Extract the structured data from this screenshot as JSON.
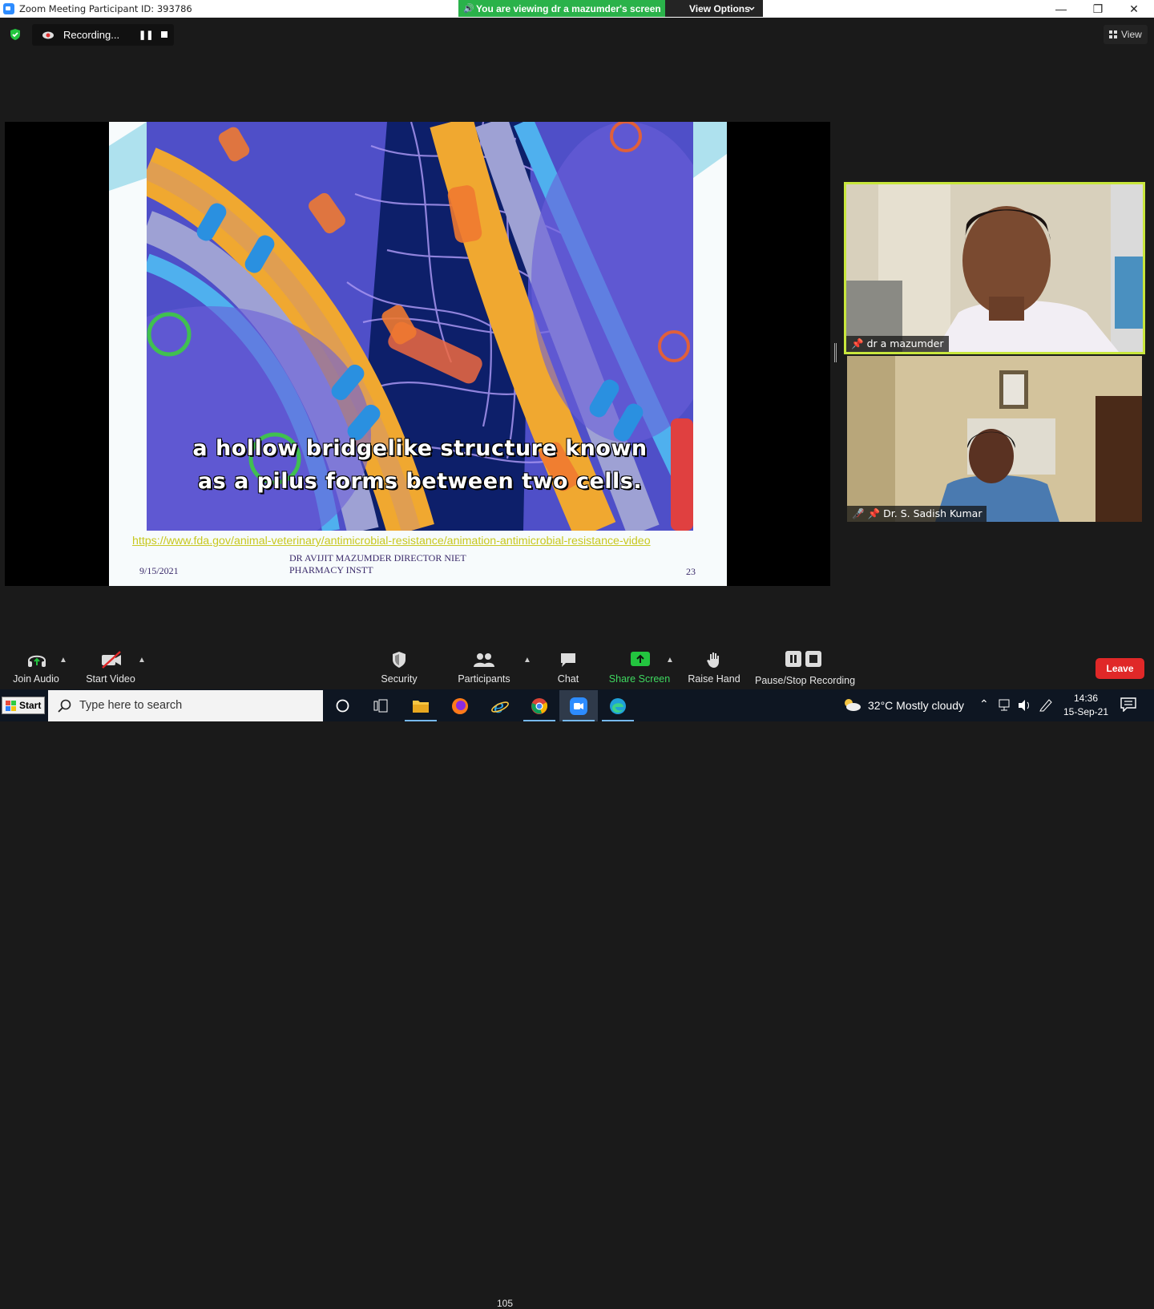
{
  "window": {
    "title": "Zoom Meeting Participant ID: 393786",
    "viewing_banner": "You are viewing dr a mazumder's screen",
    "view_options": "View Options",
    "minimize": "—",
    "maximize": "❐",
    "close": "✕"
  },
  "top_bar": {
    "recording_label": "Recording...",
    "view_label": "View"
  },
  "slide": {
    "caption_line1": "a hollow bridgelike structure known",
    "caption_line2": "as a pilus forms between two cells.",
    "url": "https://www.fda.gov/animal-veterinary/antimicrobial-resistance/animation-antimicrobial-resistance-video",
    "date": "9/15/2021",
    "author_line1": "DR AVIJIT MAZUMDER DIRECTOR NIET",
    "author_line2": "PHARMACY INSTT",
    "page_number": "23"
  },
  "participants": [
    {
      "name": "dr a mazumder",
      "active_speaker": true,
      "muted": false
    },
    {
      "name": "Dr. S. Sadish Kumar",
      "active_speaker": false,
      "muted": true
    }
  ],
  "toolbar": {
    "join_audio": "Join Audio",
    "start_video": "Start Video",
    "security": "Security",
    "participants": "Participants",
    "participants_count": "105",
    "chat": "Chat",
    "share_screen": "Share Screen",
    "raise_hand": "Raise Hand",
    "pause_stop_recording": "Pause/Stop Recording",
    "leave": "Leave"
  },
  "taskbar": {
    "start": "Start",
    "search_placeholder": "Type here to search",
    "weather": "32°C  Mostly cloudy",
    "time": "14:36",
    "date": "15-Sep-21"
  },
  "colors": {
    "accent_green": "#2ab24a",
    "active_speaker_border": "#c8e63c",
    "leave_red": "#e02828",
    "share_green": "#23c43f"
  }
}
